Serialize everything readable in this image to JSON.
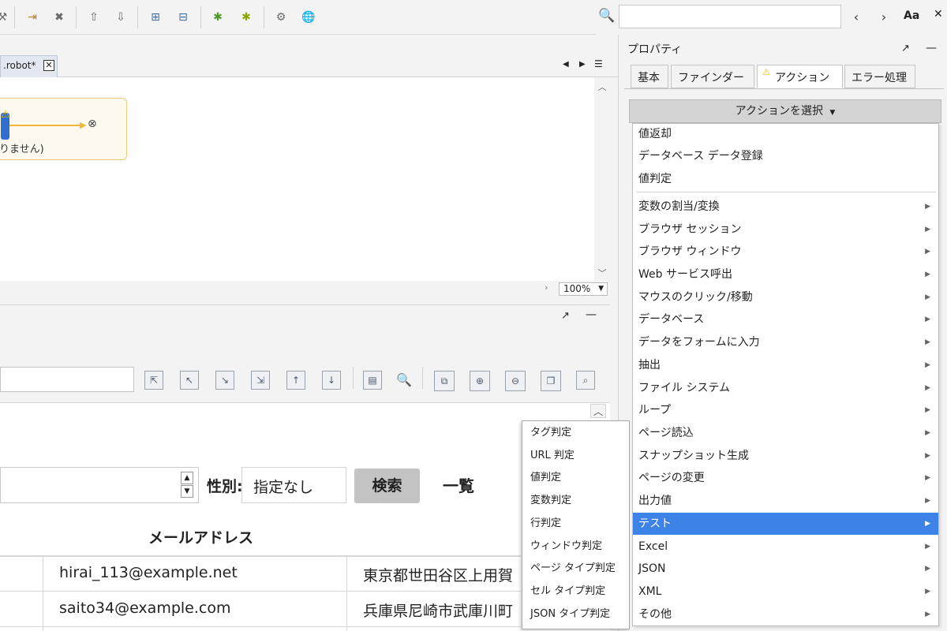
{
  "editor": {
    "tab_label": ".robot*",
    "tab_close": "✕",
    "node_text": "りません)",
    "zoom": "100%"
  },
  "search": {
    "placeholder": "",
    "match_case": "Aa"
  },
  "properties": {
    "title": "プロパティ",
    "tabs": [
      "基本",
      "ファインダー",
      "アクション",
      "エラー処理"
    ],
    "action_select": "アクションを選択"
  },
  "action_menu": {
    "top_items": [
      "値返却",
      "データベース データ登録",
      "値判定"
    ],
    "items": [
      "変数の割当/変換",
      "ブラウザ セッション",
      "ブラウザ ウィンドウ",
      "Web サービス呼出",
      "マウスのクリック/移動",
      "データベース",
      "データをフォームに入力",
      "抽出",
      "ファイル システム",
      "ループ",
      "ページ読込",
      "スナップショット生成",
      "ページの変更",
      "出力値",
      "テスト",
      "Excel",
      "JSON",
      "XML",
      "その他"
    ],
    "active_item": "テスト"
  },
  "test_submenu": {
    "items": [
      "タグ判定",
      "URL 判定",
      "値判定",
      "変数判定",
      "行判定",
      "ウィンドウ判定",
      "ページ タイプ判定",
      "セル タイプ判定",
      "JSON タイプ判定"
    ]
  },
  "web_page": {
    "gender_label": "性別:",
    "gender_value": "指定なし",
    "search_button": "検索",
    "list_link": "一覧",
    "email_header": "メールアドレス",
    "rows": [
      {
        "email": "hirai_113@example.net",
        "address": "東京都世田谷区上用賀"
      },
      {
        "email": "saito34@example.com",
        "address": "兵庫県尼崎市武庫川町"
      }
    ]
  },
  "colors": {
    "menu_highlight": "#3d82e6",
    "warning": "#f5b800"
  }
}
